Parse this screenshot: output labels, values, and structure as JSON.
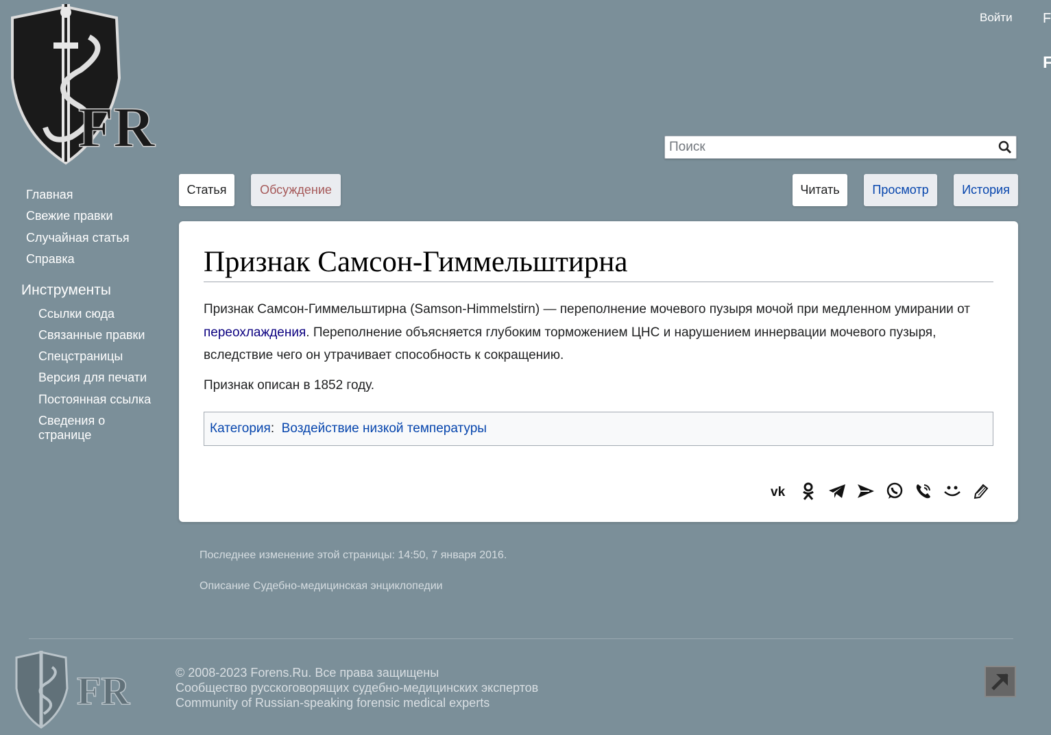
{
  "header": {
    "login": "Войти",
    "edge_fragment_1": "F",
    "edge_fragment_2": "F"
  },
  "search": {
    "placeholder": "Поиск"
  },
  "sidebar": {
    "nav": [
      "Главная",
      "Свежие правки",
      "Случайная статья",
      "Справка"
    ],
    "tools_heading": "Инструменты",
    "tools": [
      "Ссылки сюда",
      "Связанные правки",
      "Спецстраницы",
      "Версия для печати",
      "Постоянная ссылка",
      "Сведения о странице"
    ]
  },
  "tabs": {
    "article": "Статья",
    "discussion": "Обсуждение",
    "read": "Читать",
    "view": "Просмотр",
    "history": "История"
  },
  "article": {
    "title": "Признак Самсон-Гиммельштирна",
    "p1_before": "Признак Самсон-Гиммельштирна (Samson-Himmelstirn) — переполнение мочевого пузыря мочой при медленном умирании от ",
    "p1_link": "переохлаждения",
    "p1_after": ". Переполнение объясняется глубоким торможением ЦНС и нарушением иннервации мочевого пузыря, вследствие чего он утрачивает способность к сокращению.",
    "p2": "Признак описан в 1852 году.",
    "category_label": "Категория",
    "category_value": "Воздействие низкой температуры"
  },
  "share_icons": [
    "vk-icon",
    "odnoklassniki-icon",
    "telegram-icon",
    "send-icon",
    "whatsapp-icon",
    "viber-icon",
    "smile-icon",
    "edit-icon"
  ],
  "footer": {
    "last_modified": "Последнее изменение этой страницы: 14:50, 7 января 2016.",
    "about": "Описание Судебно-медицинская энциклопедии",
    "copyright": "© 2008-2023 Forens.Ru. Все права защищены",
    "community_ru": "Сообщество русскоговорящих судебно-медицинских экспертов",
    "community_en": "Community of Russian-speaking forensic medical experts"
  },
  "colors": {
    "background": "#7b8f99",
    "link": "#0645ad",
    "visited_link": "#0b0080",
    "discussion_tab": "#a55858"
  }
}
